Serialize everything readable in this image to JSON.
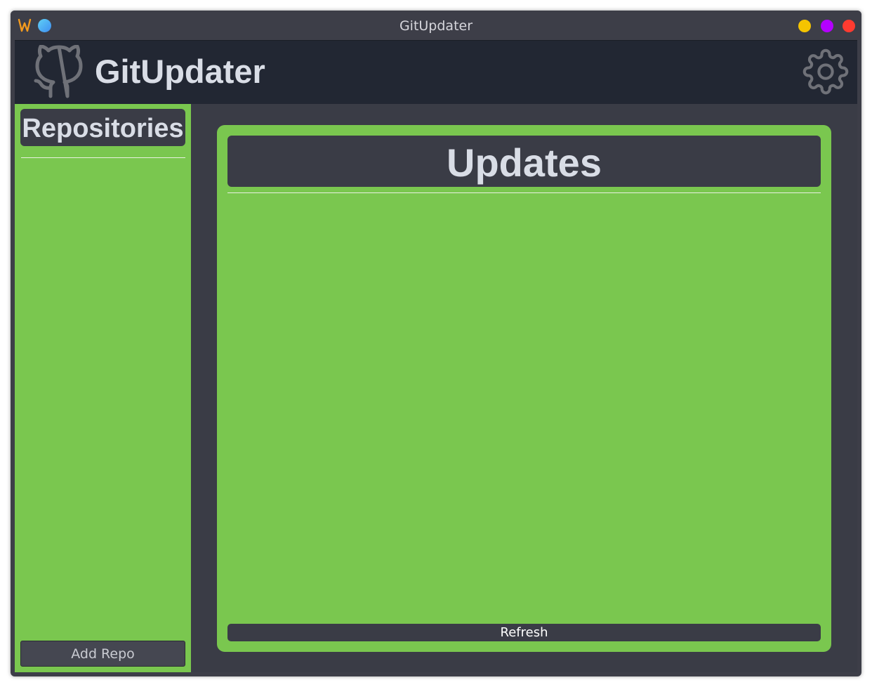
{
  "window": {
    "title": "GitUpdater",
    "controls": {
      "minimize_color": "#f5c400",
      "maximize_color": "#b400ff",
      "close_color": "#ff3b30"
    },
    "app_icons": [
      "w-logo-icon",
      "blue-dot-icon"
    ]
  },
  "header": {
    "logo_icon": "github-icon",
    "title": "GitUpdater",
    "settings_icon": "gear-icon"
  },
  "sidebar": {
    "heading": "Repositories",
    "items": [],
    "add_button_label": "Add Repo"
  },
  "updates": {
    "heading": "Updates",
    "items": [],
    "refresh_label": "Refresh"
  },
  "colors": {
    "panel_green": "#7ac74f",
    "background_dark": "#3a3c46",
    "header_bg": "#222733",
    "text_light": "#d9dde6"
  }
}
